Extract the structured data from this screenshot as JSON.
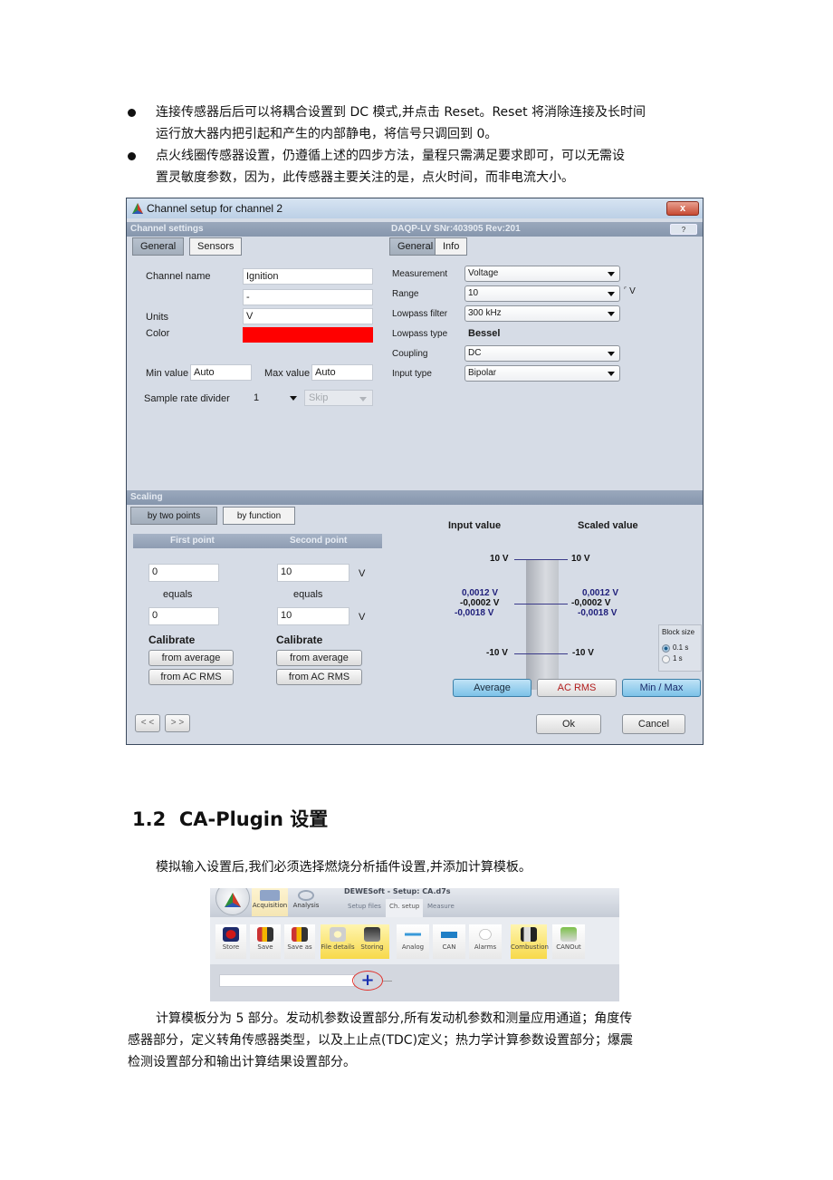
{
  "doc": {
    "bullets": [
      {
        "lines": [
          "连接传感器后后可以将耦合设置到 DC 模式,并点击 Reset。Reset 将消除连接及长时间",
          "运行放大器内把引起和产生的内部静电，将信号只调回到 0。"
        ]
      },
      {
        "lines": [
          "点火线圈传感器设置，仍遵循上述的四步方法，量程只需满足要求即可，可以无需设",
          "置灵敏度参数，因为，此传感器主要关注的是，点火时间，而非电流大小。"
        ]
      }
    ],
    "section_heading": "1.2  CA-Plugin 设置",
    "intro_paragraph": "模拟输入设置后,我们必须选择燃烧分析插件设置,并添加计算模板。",
    "closing_paragraph": [
      "计算模板分为 5 部分。发动机参数设置部分,所有发动机参数和测量应用通道；角度传",
      "感器部分，定义转角传感器类型，以及上止点(TDC)定义；热力学计算参数设置部分；爆震",
      "检测设置部分和输出计算结果设置部分。"
    ]
  },
  "dialog": {
    "title": "Channel setup for channel 2",
    "close_label": "x",
    "channel_settings_header": "Channel settings",
    "device_header": "DAQP-LV  SNr:403905 Rev:201",
    "help_label": "?",
    "left_tabs": [
      {
        "label": "General",
        "active": true
      },
      {
        "label": "Sensors",
        "active": false
      }
    ],
    "right_tabs": [
      {
        "label": "General",
        "active": true
      },
      {
        "label": "Info",
        "active": false
      }
    ],
    "channel_name_label": "Channel name",
    "channel_name_value": "Ignition",
    "description_value": "-",
    "units_label": "Units",
    "units_value": "V",
    "color_label": "Color",
    "color_value": "#ff0000",
    "min_value_label": "Min value",
    "min_value": "Auto",
    "max_value_label": "Max value",
    "max_value": "Auto",
    "sample_rate_divider_label": "Sample rate divider",
    "sample_rate_divider_value": "1",
    "skip_value": "Skip",
    "measurement_label": "Measurement",
    "measurement_value": "Voltage",
    "range_label": "Range",
    "range_value": "10",
    "range_unit": "V",
    "lowpass_filter_label": "Lowpass filter",
    "lowpass_filter_value": "300 kHz",
    "lowpass_type_label": "Lowpass type",
    "lowpass_type_value": "Bessel",
    "coupling_label": "Coupling",
    "coupling_value": "DC",
    "input_type_label": "Input type",
    "input_type_value": "Bipolar",
    "scaling": {
      "header": "Scaling",
      "tabs": [
        {
          "label": "by two points",
          "active": true
        },
        {
          "label": "by function",
          "active": false
        }
      ],
      "first_point_header": "First point",
      "second_point_header": "Second point",
      "first_input": "0",
      "second_input": "10",
      "input_unit": "V",
      "equals_label": "equals",
      "first_scaled": "0",
      "second_scaled": "10",
      "scaled_unit": "V",
      "calibrate_label": "Calibrate",
      "from_average_label": "from average",
      "from_ac_rms_label": "from AC RMS"
    },
    "monitor": {
      "input_header": "Input value",
      "scaled_header": "Scaled value",
      "input_top": "10 V",
      "scaled_top": "10 V",
      "input_max": "0,0012 V",
      "input_avg": "-0,0002 V",
      "input_min": "-0,0018 V",
      "scaled_max": "0,0012 V",
      "scaled_avg": "-0,0002 V",
      "scaled_min": "-0,0018 V",
      "input_bottom": "-10 V",
      "scaled_bottom": "-10 V",
      "block_size_label": "Block size",
      "block_options": [
        {
          "label": "0.1 s",
          "selected": true
        },
        {
          "label": "1 s",
          "selected": false
        }
      ],
      "average_label": "Average",
      "ac_rms_label": "AC RMS",
      "min_max_label": "Min / Max"
    },
    "prev_label": "< <",
    "next_label": "> >",
    "ok_label": "Ok",
    "cancel_label": "Cancel"
  },
  "app_screenshot": {
    "title": "DEWESoft - Setup: CA.d7s",
    "mode_buttons": [
      "Acquisition",
      "Analysis"
    ],
    "tabs": [
      "Setup files",
      "Ch. setup",
      "Measure"
    ],
    "active_tab": "Ch. setup",
    "toolbar": [
      {
        "label": "Store",
        "icon": "record-icon"
      },
      {
        "label": "Save",
        "icon": "save-icon"
      },
      {
        "label": "Save as",
        "icon": "save-as-icon"
      },
      {
        "label": "File details",
        "icon": "gear-icon"
      },
      {
        "label": "Storing",
        "icon": "disk-icon"
      },
      {
        "label": "Analog",
        "icon": "analog-icon"
      },
      {
        "label": "CAN",
        "icon": "car-icon"
      },
      {
        "label": "Alarms",
        "icon": "alarm-icon"
      },
      {
        "label": "Combustion",
        "icon": "combustion-icon"
      },
      {
        "label": "CANOut",
        "icon": "can-out-icon"
      }
    ],
    "add_button_label": "+"
  }
}
